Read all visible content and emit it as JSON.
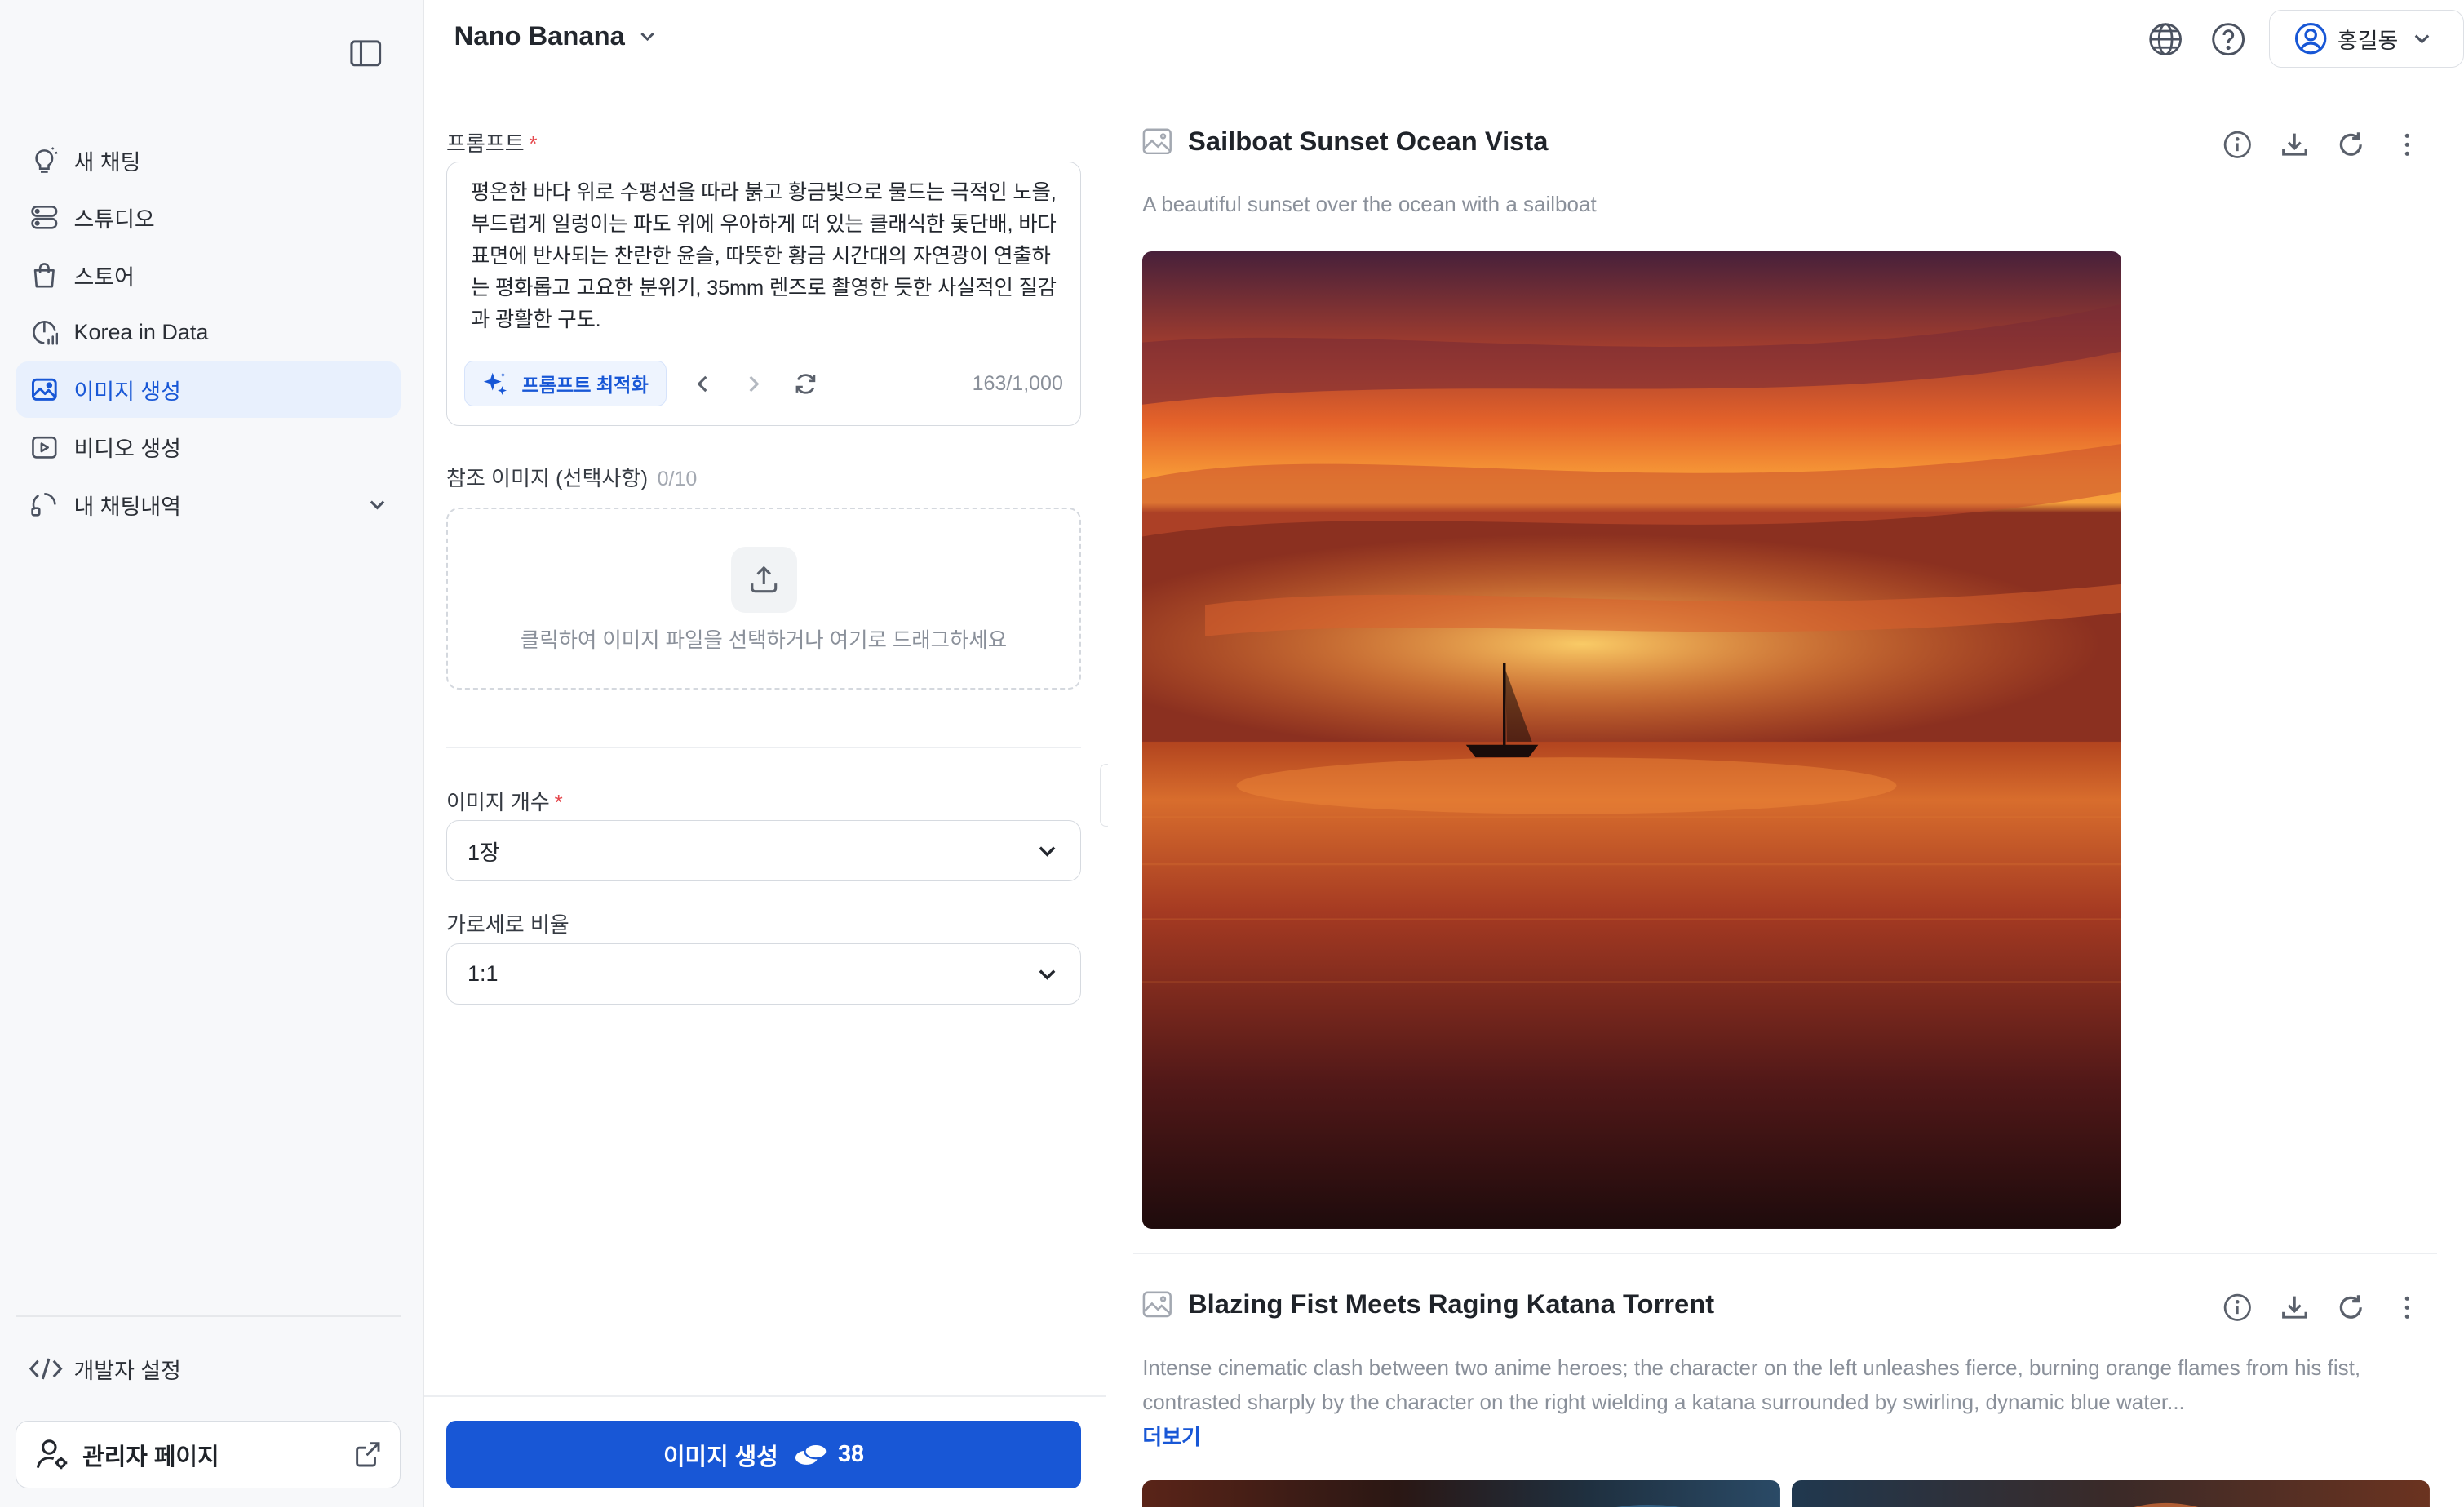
{
  "sidebar": {
    "items": [
      {
        "label": "새 채팅",
        "icon": "lightbulb-icon"
      },
      {
        "label": "스튜디오",
        "icon": "studio-icon"
      },
      {
        "label": "스토어",
        "icon": "shopping-bag-icon"
      },
      {
        "label": "Korea in Data",
        "icon": "data-chart-icon"
      },
      {
        "label": "이미지 생성",
        "icon": "image-icon",
        "active": true
      },
      {
        "label": "비디오 생성",
        "icon": "video-icon"
      },
      {
        "label": "내 채팅내역",
        "icon": "chat-history-icon"
      }
    ],
    "dev_settings": "개발자 설정",
    "admin_page": "관리자 페이지"
  },
  "header": {
    "model": "Nano Banana",
    "user": "홍길동"
  },
  "form": {
    "prompt_label": "프롬프트",
    "required_mark": "*",
    "prompt_text": "평온한 바다 위로 수평선을 따라 붉고 황금빛으로 물드는 극적인 노을, 부드럽게 일렁이는 파도 위에 우아하게 떠 있는 클래식한 돛단배, 바다 표면에 반사되는 찬란한 윤슬, 따뜻한 황금 시간대의 자연광이 연출하는 평화롭고 고요한 분위기, 35mm 렌즈로 촬영한 듯한 사실적인 질감과 광활한 구도.",
    "optimize_label": "프롬프트 최적화",
    "char_count": "163/1,000",
    "ref_label": "참조 이미지 (선택사항)",
    "ref_count": "0/10",
    "dropzone_text": "클릭하여 이미지 파일을 선택하거나 여기로 드래그하세요",
    "count_label": "이미지 개수",
    "count_value": "1장",
    "ratio_label": "가로세로 비율",
    "ratio_value": "1:1",
    "generate_label": "이미지 생성",
    "credits": "38"
  },
  "results": [
    {
      "title": "Sailboat Sunset Ocean Vista",
      "description": "A beautiful sunset over the ocean with a sailboat"
    },
    {
      "title": "Blazing Fist Meets Raging Katana Torrent",
      "description": "Intense cinematic clash between two anime heroes; the character on the left unleashes fierce, burning orange flames from his fist, contrasted sharply by the character on the right wielding a katana surrounded by swirling, dynamic blue water...",
      "more": "더보기"
    }
  ],
  "colors": {
    "accent": "#1857d6",
    "active_bg": "#e8f0fd",
    "required": "#e5484d"
  }
}
